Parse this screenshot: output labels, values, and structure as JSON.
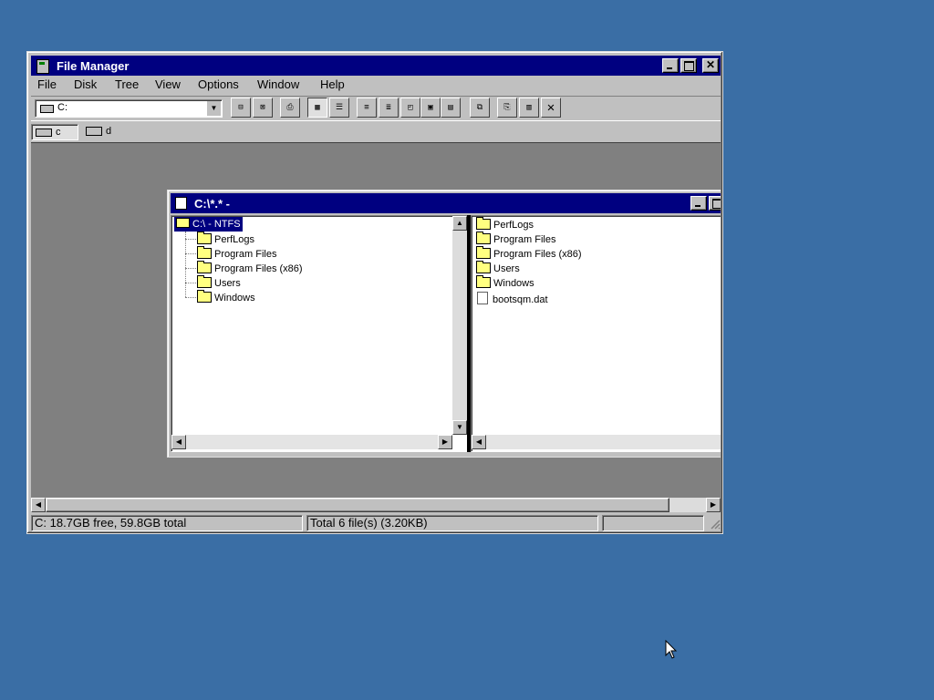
{
  "main_window": {
    "title": "File Manager",
    "menu": [
      "File",
      "Disk",
      "Tree",
      "View",
      "Options",
      "Window",
      "Help"
    ],
    "drive_selector_value": "C:",
    "drives": [
      "c",
      "d"
    ],
    "status": {
      "left": "C: 18.7GB free,  59.8GB total",
      "middle": "Total 6 file(s) (3.20KB)",
      "right": ""
    }
  },
  "child_window": {
    "title": "C:\\*.* -",
    "tree": {
      "root": "C:\\ - NTFS",
      "items": [
        "PerfLogs",
        "Program Files",
        "Program Files (x86)",
        "Users",
        "Windows"
      ]
    },
    "list": {
      "folders": [
        "PerfLogs",
        "Program Files",
        "Program Files (x86)",
        "Users",
        "Windows"
      ],
      "files": [
        "bootsqm.dat"
      ]
    }
  },
  "colors": {
    "desktop": "#3a6ea5",
    "title_bar": "#000080",
    "chrome": "#c0c0c0",
    "mdi_background": "#808080",
    "folder": "#ffff80"
  },
  "icons": {
    "drive": "drive-icon",
    "folder": "folder-icon",
    "file": "file-icon"
  }
}
